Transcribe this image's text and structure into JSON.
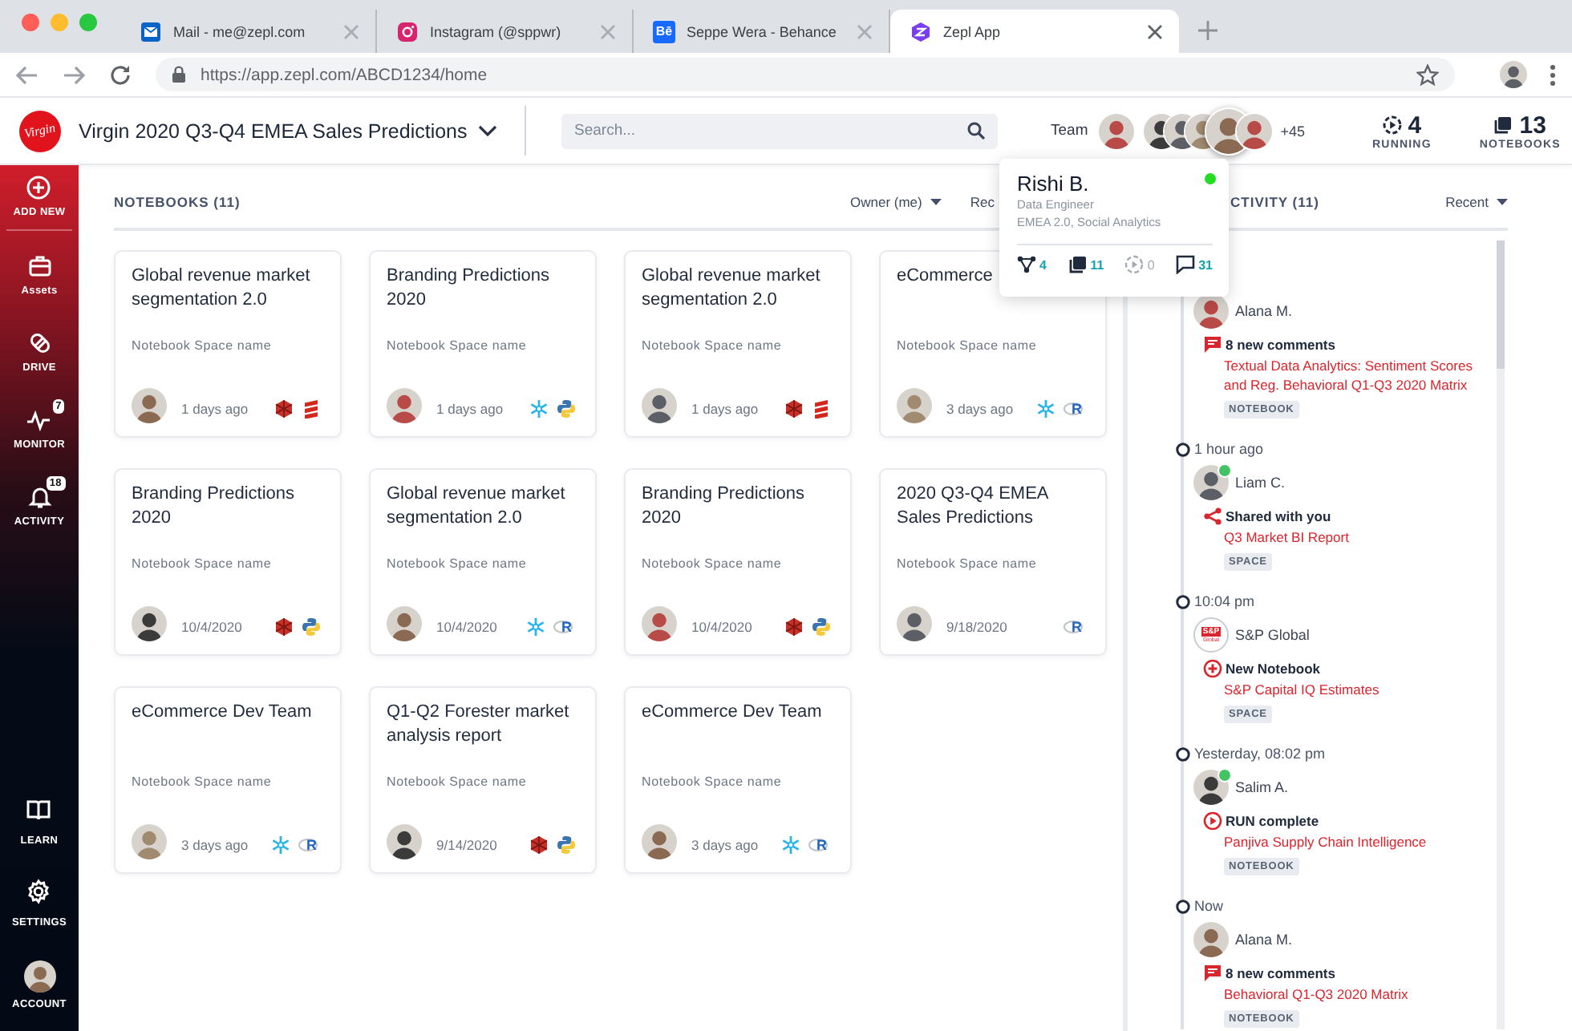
{
  "browser": {
    "tabs": [
      {
        "kind": "mail",
        "title": "Mail - me@zepl.com",
        "selected": false
      },
      {
        "kind": "camera",
        "title": "Instagram (@sppwr)",
        "selected": false
      },
      {
        "kind": "behance",
        "favicon_text": "Bē",
        "title": "Seppe Wera - Behance",
        "selected": false
      },
      {
        "kind": "zepl",
        "title": "Zepl App",
        "selected": true
      }
    ],
    "url": "https://app.zepl.com/ABCD1234/home"
  },
  "header": {
    "logo_text": "Virgin",
    "title": "Virgin 2020 Q3-Q4 EMEA Sales Predictions",
    "search": {
      "placeholder": "Search..."
    },
    "team_label": "Team",
    "team_more": "+45",
    "stats": [
      {
        "kind": "running",
        "value": "4",
        "label": "RUNNING"
      },
      {
        "kind": "notebooks",
        "value": "13",
        "label": "NOTEBOOKS"
      }
    ]
  },
  "sidebar": {
    "items": [
      {
        "kind": "add",
        "label": "ADD NEW"
      },
      {
        "kind": "assets",
        "label": "Assets"
      },
      {
        "kind": "drive",
        "label": "DRIVE"
      },
      {
        "kind": "monitor",
        "label": "MONITOR",
        "badge": "7"
      },
      {
        "kind": "activity",
        "label": "ACTIVITY",
        "badge": "18"
      }
    ],
    "bottom_items": [
      {
        "kind": "learn",
        "label": "LEARN"
      },
      {
        "kind": "settings",
        "label": "SETTINGS"
      },
      {
        "kind": "account",
        "label": "ACCOUNT"
      }
    ]
  },
  "notebooks": {
    "title": "NOTEBOOKS (11)",
    "filters": [
      {
        "label": "Owner (me)",
        "dropdown": true
      },
      {
        "label": "Rec",
        "dropdown": false
      }
    ],
    "cards": [
      {
        "title": "Global revenue market segmentation 2.0",
        "space": "Notebook Space name",
        "date": "1 days ago",
        "tools": [
          {
            "kind": "cube"
          },
          {
            "kind": "stack"
          }
        ]
      },
      {
        "title": "Branding Predictions 2020",
        "space": "Notebook Space name",
        "date": "1 days ago",
        "tools": [
          {
            "kind": "snowflake"
          },
          {
            "kind": "python"
          }
        ]
      },
      {
        "title": "Global revenue market segmentation 2.0",
        "space": "Notebook Space name",
        "date": "1 days ago",
        "tools": [
          {
            "kind": "cube"
          },
          {
            "kind": "stack"
          }
        ]
      },
      {
        "title": "eCommerce",
        "space": "Notebook Space name",
        "date": "3 days ago",
        "tools": [
          {
            "kind": "snowflake"
          },
          {
            "kind": "r",
            "label": "R"
          }
        ]
      },
      {
        "title": "Branding Predictions 2020",
        "space": "Notebook Space name",
        "date": "10/4/2020",
        "tools": [
          {
            "kind": "cube"
          },
          {
            "kind": "python"
          }
        ]
      },
      {
        "title": "Global revenue market segmentation 2.0",
        "space": "Notebook Space name",
        "date": "10/4/2020",
        "tools": [
          {
            "kind": "snowflake"
          },
          {
            "kind": "r",
            "label": "R"
          }
        ]
      },
      {
        "title": "Branding Predictions 2020",
        "space": "Notebook Space name",
        "date": "10/4/2020",
        "tools": [
          {
            "kind": "cube"
          },
          {
            "kind": "python"
          }
        ]
      },
      {
        "title": "2020 Q3-Q4 EMEA Sales Predictions",
        "space": "Notebook Space name",
        "date": "9/18/2020",
        "tools": [
          {
            "kind": "r",
            "label": "R"
          }
        ]
      },
      {
        "title": "eCommerce Dev Team",
        "space": "Notebook Space name",
        "date": "3 days ago",
        "tools": [
          {
            "kind": "snowflake"
          },
          {
            "kind": "r",
            "label": "R"
          }
        ]
      },
      {
        "title": "Q1-Q2 Forester market analysis report",
        "space": "Notebook Space name",
        "date": "9/14/2020",
        "tools": [
          {
            "kind": "cube"
          },
          {
            "kind": "python"
          }
        ]
      },
      {
        "title": "eCommerce Dev Team",
        "space": "Notebook Space name",
        "date": "3 days ago",
        "tools": [
          {
            "kind": "snowflake"
          },
          {
            "kind": "r",
            "label": "R"
          }
        ]
      }
    ]
  },
  "activity": {
    "title": "CTIVITY (11)",
    "sort": "Recent",
    "items": [
      {
        "user": "Alana M.",
        "avatar": {
          "kind": "person"
        },
        "online": false,
        "kind": "comment",
        "action": "8 new comments",
        "link": "Textual Data Analytics: Sentiment Scores and Reg. Behavioral Q1-Q3 2020 Matrix",
        "tag": "NOTEBOOK"
      },
      {
        "time": "1 hour ago",
        "user": "Liam C.",
        "avatar": {
          "kind": "person"
        },
        "online": true,
        "kind": "share",
        "action": "Shared with you",
        "link": "Q3 Market BI Report",
        "tag": "SPACE"
      },
      {
        "time": "10:04 pm",
        "user": "S&P Global",
        "avatar": {
          "kind": "logo",
          "lines": [
            "S&P",
            "Global"
          ]
        },
        "online": false,
        "kind": "new",
        "action": "New Notebook",
        "link": "S&P Capital IQ Estimates",
        "tag": "SPACE"
      },
      {
        "time": "Yesterday, 08:02 pm",
        "user": "Salim A.",
        "avatar": {
          "kind": "person"
        },
        "online": true,
        "kind": "run",
        "action": "RUN complete",
        "link": "Panjiva Supply Chain Intelligence",
        "tag": "NOTEBOOK"
      },
      {
        "time": "Now",
        "user": "Alana M.",
        "avatar": {
          "kind": "person"
        },
        "online": false,
        "kind": "comment",
        "action": "8 new comments",
        "link": "Behavioral Q1-Q3 2020 Matrix",
        "tag": "NOTEBOOK"
      }
    ]
  },
  "popover": {
    "name": "Rishi B.",
    "role": "Data Engineer",
    "teams": "EMEA 2.0, Social Analytics",
    "online": true,
    "stats": [
      {
        "kind": "branch",
        "value": "4",
        "muted": false
      },
      {
        "kind": "notebooks",
        "value": "11",
        "muted": false
      },
      {
        "kind": "run",
        "value": "0",
        "muted": true
      },
      {
        "kind": "comments",
        "value": "31",
        "muted": false
      }
    ]
  }
}
